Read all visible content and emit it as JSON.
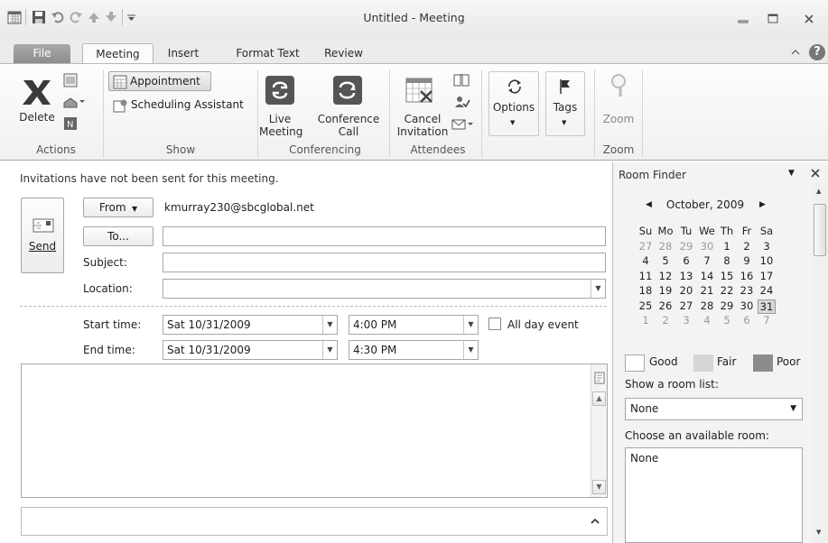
{
  "window": {
    "title": "Untitled - Meeting"
  },
  "tabs": [
    {
      "label": "File"
    },
    {
      "label": "Meeting"
    },
    {
      "label": "Insert"
    },
    {
      "label": "Format Text"
    },
    {
      "label": "Review"
    }
  ],
  "ribbon": {
    "actions": {
      "delete": "Delete",
      "group": "Actions"
    },
    "show": {
      "appointment": "Appointment",
      "scheduling": "Scheduling Assistant",
      "group": "Show"
    },
    "conferencing": {
      "live1": "Live",
      "live2": "Meeting",
      "conf1": "Conference",
      "conf2": "Call",
      "group": "Conferencing"
    },
    "attendees": {
      "cancel1": "Cancel",
      "cancel2": "Invitation",
      "group": "Attendees"
    },
    "options": {
      "label": "Options"
    },
    "tags": {
      "label": "Tags"
    },
    "zoom": {
      "label": "Zoom",
      "group": "Zoom"
    }
  },
  "infobar": "Invitations have not been sent for this meeting.",
  "form": {
    "send": "Send",
    "from_label": "From",
    "from_value": "kmurray230@sbcglobal.net",
    "to_label": "To...",
    "to_value": "",
    "subject_label": "Subject:",
    "subject_value": "",
    "location_label": "Location:",
    "location_value": "",
    "start_label": "Start time:",
    "start_date": "Sat 10/31/2009",
    "start_time": "4:00 PM",
    "allday_label": "All day event",
    "end_label": "End time:",
    "end_date": "Sat 10/31/2009",
    "end_time": "4:30 PM"
  },
  "room_finder": {
    "title": "Room Finder",
    "month": "October, 2009",
    "weekdays": [
      "Su",
      "Mo",
      "Tu",
      "We",
      "Th",
      "Fr",
      "Sa"
    ],
    "weeks": [
      [
        "27",
        "28",
        "29",
        "30",
        "1",
        "2",
        "3"
      ],
      [
        "4",
        "5",
        "6",
        "7",
        "8",
        "9",
        "10"
      ],
      [
        "11",
        "12",
        "13",
        "14",
        "15",
        "16",
        "17"
      ],
      [
        "18",
        "19",
        "20",
        "21",
        "22",
        "23",
        "24"
      ],
      [
        "25",
        "26",
        "27",
        "28",
        "29",
        "30",
        "31"
      ],
      [
        "1",
        "2",
        "3",
        "4",
        "5",
        "6",
        "7"
      ]
    ],
    "selected_day": "31",
    "legend": {
      "good": "Good",
      "fair": "Fair",
      "poor": "Poor"
    },
    "room_list_label": "Show a room list:",
    "room_list_value": "None",
    "available_label": "Choose an available room:",
    "available_value": "None"
  },
  "colors": {
    "fair": "#d6d6d6",
    "poor": "#8c8c8c",
    "selected_day": "#d8d8d8"
  }
}
